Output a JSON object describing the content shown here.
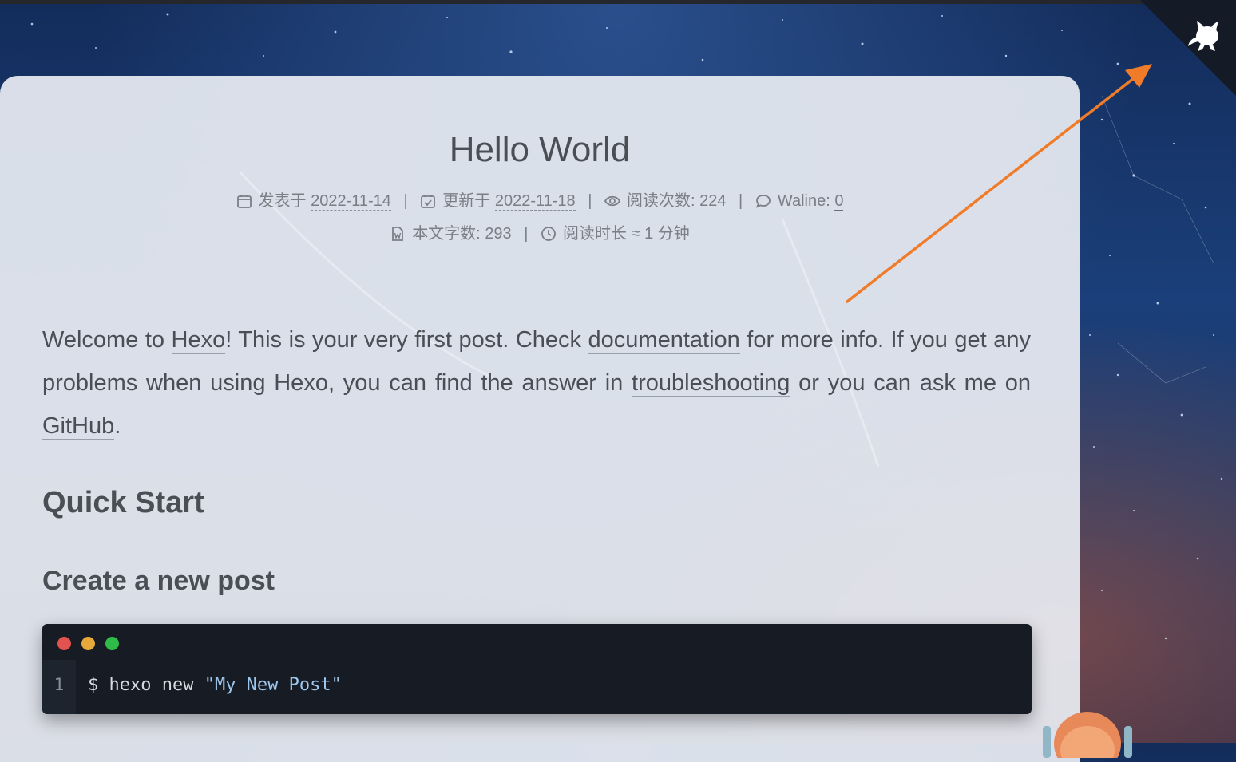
{
  "post": {
    "title": "Hello World",
    "meta_line1": {
      "published_label": "发表于",
      "published_date": "2022-11-14",
      "updated_label": "更新于",
      "updated_date": "2022-11-18",
      "views_label": "阅读次数:",
      "views_count": "224",
      "comments_label": "Waline:",
      "comments_count": "0",
      "separator": "|"
    },
    "meta_line2": {
      "wordcount_label": "本文字数:",
      "wordcount_value": "293",
      "readtime_label": "阅读时长 ≈",
      "readtime_value": "1 分钟",
      "separator": "|"
    },
    "intro": {
      "t1": "Welcome to ",
      "link_hexo": "Hexo",
      "t2": "! This is your very first post. Check ",
      "link_docs": "documentation",
      "t3": " for more info. If you get any problems when using Hexo, you can find the answer in ",
      "link_troubleshooting": "troubleshooting",
      "t4": " or you can ask me on ",
      "link_github": "GitHub",
      "t5": "."
    },
    "heading_quick_start": "Quick Start",
    "heading_create_post": "Create a new post",
    "code_block": {
      "line_number": "1",
      "command": "$ hexo new ",
      "argument": "\"My New Post\"",
      "dot_colors": [
        "#e0534e",
        "#e6a93a",
        "#2fbb48"
      ]
    }
  },
  "github_corner": {
    "icon": "github-octocat-icon"
  },
  "annotation": {
    "arrow_color": "#f07c2a"
  },
  "colors": {
    "card_bg": "#e8ecf2",
    "text": "#4a4f56",
    "meta_text": "#7a7f86",
    "code_bg": "#161b24"
  }
}
